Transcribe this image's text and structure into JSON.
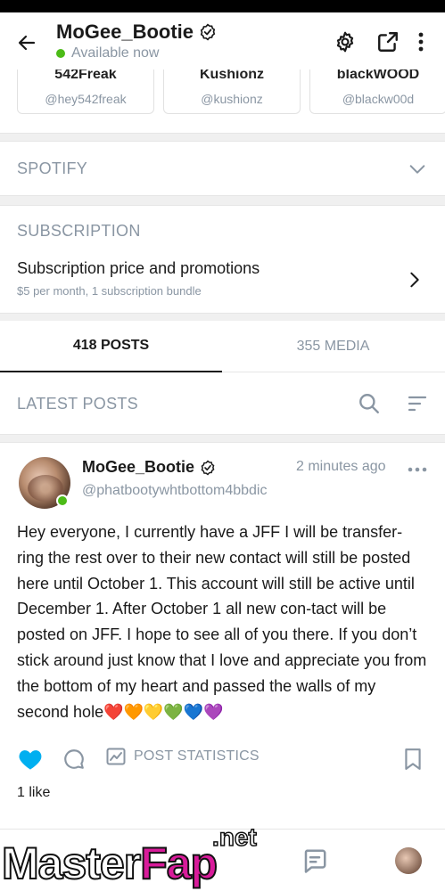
{
  "header": {
    "title": "MoGee_Bootie",
    "status": "Available now"
  },
  "suggested": [
    {
      "name": "542Freak",
      "handle": "@hey542freak"
    },
    {
      "name": "Kushionz",
      "handle": "@kushionz"
    },
    {
      "name": "blackWOOD",
      "handle": "@blackw00d"
    }
  ],
  "spotify": {
    "label": "SPOTIFY"
  },
  "subscription": {
    "label": "SUBSCRIPTION",
    "title": "Subscription price and promotions",
    "description": "$5 per month, 1 subscription bundle"
  },
  "tabs": [
    {
      "label": "418 POSTS",
      "active": true
    },
    {
      "label": "355 MEDIA",
      "active": false
    }
  ],
  "latest": {
    "label": "LATEST POSTS"
  },
  "post": {
    "author": "MoGee_Bootie",
    "handle": "@phatbootywhtbottom4bbdic",
    "time": "2 minutes ago",
    "text": "Hey everyone, I currently have a JFF I will be transfer-ring the rest over to their new contact will still be posted here until October 1. This account will still be active until December 1. After October 1 all new con-tact will be posted on JFF. I hope to see all of you there. If you don’t stick around just know that I love and appreciate you from the bottom of my heart and passed the walls of my second hole❤️🧡💛💚💙💜",
    "stats_label": "POST STATISTICS",
    "likes": "1 like"
  },
  "watermark": {
    "part1": "Master",
    "part2": "Fap",
    "suffix": ".net"
  },
  "colors": {
    "accent": "#00aff0",
    "muted": "#8a96a3",
    "online": "#4cbb17"
  }
}
